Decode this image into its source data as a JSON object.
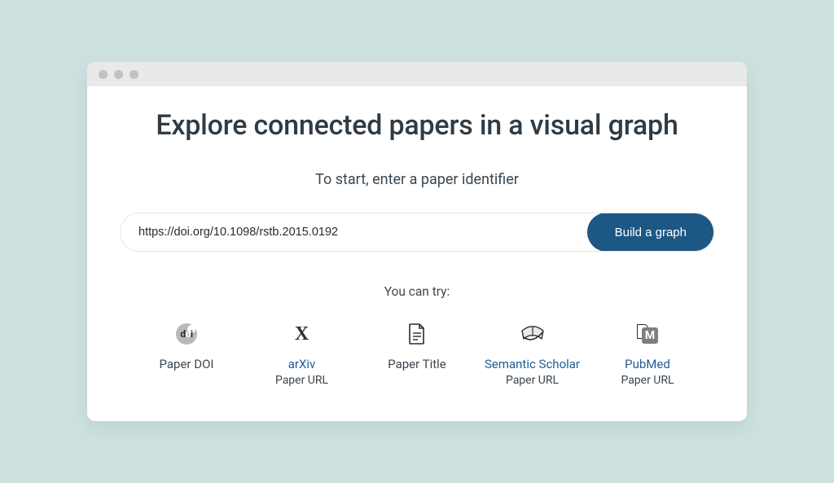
{
  "heading": "Explore connected papers in a visual graph",
  "subheading": "To start, enter a paper identifier",
  "search": {
    "value": "https://doi.org/10.1098/rstb.2015.0192",
    "button": "Build a graph"
  },
  "try_label": "You can try:",
  "options": [
    {
      "title": "Paper DOI",
      "sub": "",
      "is_link": false,
      "icon": "doi"
    },
    {
      "title": "arXiv",
      "sub": "Paper URL",
      "is_link": true,
      "icon": "arxiv"
    },
    {
      "title": "Paper Title",
      "sub": "",
      "is_link": false,
      "icon": "document"
    },
    {
      "title": "Semantic Scholar",
      "sub": "Paper URL",
      "is_link": true,
      "icon": "semantic-scholar"
    },
    {
      "title": "PubMed",
      "sub": "Paper URL",
      "is_link": true,
      "icon": "pubmed"
    }
  ]
}
